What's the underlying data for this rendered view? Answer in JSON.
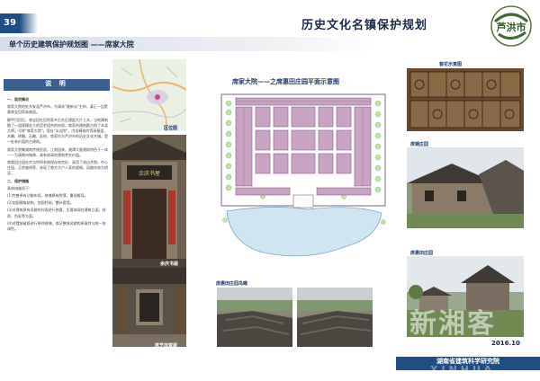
{
  "header": {
    "page_number": "39",
    "title": "历史文化名镇保护规划",
    "logo_text": "芦洪市",
    "subtitle": "单个历史建筑保护规划图 ——席家大院"
  },
  "sidebar": {
    "heading": "说  明",
    "paragraphs": [
      "一、现状情况",
      "席家大院地处东安县芦洪市，为清末\"维新派\"主帅，清正一品提督席宝田家族故居。",
      "解甲归田后，席宝田在回到家乡后先后建起大片土木，当地建筑融了一组规模宏大的官宅组合的府邸，席家的建筑群占地了本县大将，号称\"席家大院\"。现存\"半边院\"，内含精致的等高屋面、木雕、砖雕、石雕、彩绘，席家作为芦洪市的历史文化名镇，是一处有价值的古建筑。",
      "席家大院集湖南传统民居，江南园林，湘潭大屋建筑特色于一体——为清朝州城典，具有较高的建筑考究价值。",
      "席惠田庄园在宗法宗祠系统保存较完好，采用了周边合院，中心庄园，正房轴线等，体现了南方大户人家的规格，风貌亦较为明显。",
      "二、保护措施",
      "具体措施如下：",
      "(1)完善原有功能布局，修缮原有院落，重现格局。",
      "(2)加固建筑结构，加固柱础，整补套墙。",
      "(3)对建筑原有风貌的外观进行修复，主要体现在建筑立面，材质，色彩等方面。",
      "(4)对摆放破损进行原样修缮，保证整体风貌的原真性与统一协调性。"
    ]
  },
  "photos": {
    "map_caption": "区位图",
    "gate_caption": "余庆书屋",
    "hall_caption": "席芝田堂屋"
  },
  "plan": {
    "title": "席家大院——之席惠田庄园平面示意图"
  },
  "aerial": {
    "caption": "席惠田庄园鸟瞰"
  },
  "right": {
    "window_caption": "窗花示意图",
    "house_caption": "席娥庄园",
    "village_caption": "席惠田庄园"
  },
  "footer": {
    "date": "2016.10",
    "institute": "湖南省建筑科学研究院"
  },
  "watermark": {
    "main": "新湘客",
    "latin": "XINHUA"
  },
  "colors": {
    "accent": "#1f4e86",
    "plan_buildings": "#c9a3c4",
    "plan_pond": "#cfe6f2"
  }
}
